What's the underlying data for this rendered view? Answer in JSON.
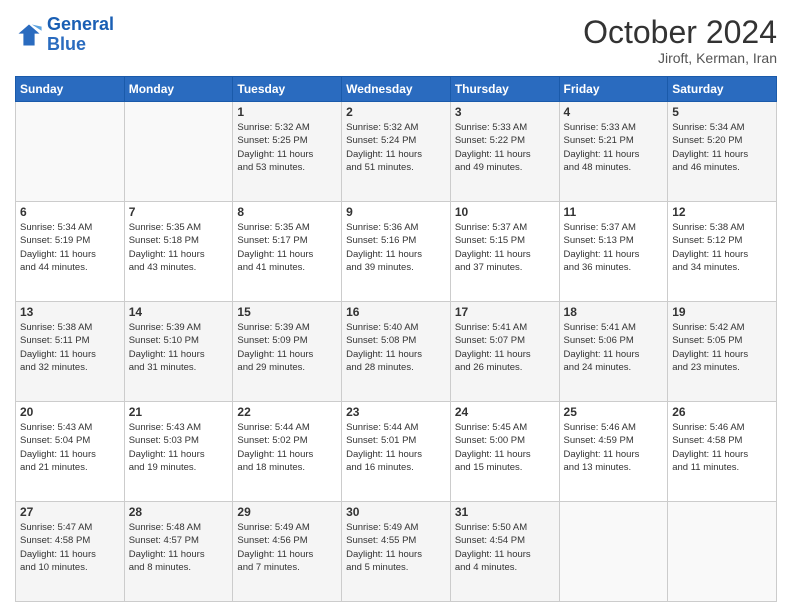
{
  "header": {
    "logo_line1": "General",
    "logo_line2": "Blue",
    "month_title": "October 2024",
    "subtitle": "Jiroft, Kerman, Iran"
  },
  "weekdays": [
    "Sunday",
    "Monday",
    "Tuesday",
    "Wednesday",
    "Thursday",
    "Friday",
    "Saturday"
  ],
  "weeks": [
    [
      {
        "day": "",
        "info": ""
      },
      {
        "day": "",
        "info": ""
      },
      {
        "day": "1",
        "info": "Sunrise: 5:32 AM\nSunset: 5:25 PM\nDaylight: 11 hours\nand 53 minutes."
      },
      {
        "day": "2",
        "info": "Sunrise: 5:32 AM\nSunset: 5:24 PM\nDaylight: 11 hours\nand 51 minutes."
      },
      {
        "day": "3",
        "info": "Sunrise: 5:33 AM\nSunset: 5:22 PM\nDaylight: 11 hours\nand 49 minutes."
      },
      {
        "day": "4",
        "info": "Sunrise: 5:33 AM\nSunset: 5:21 PM\nDaylight: 11 hours\nand 48 minutes."
      },
      {
        "day": "5",
        "info": "Sunrise: 5:34 AM\nSunset: 5:20 PM\nDaylight: 11 hours\nand 46 minutes."
      }
    ],
    [
      {
        "day": "6",
        "info": "Sunrise: 5:34 AM\nSunset: 5:19 PM\nDaylight: 11 hours\nand 44 minutes."
      },
      {
        "day": "7",
        "info": "Sunrise: 5:35 AM\nSunset: 5:18 PM\nDaylight: 11 hours\nand 43 minutes."
      },
      {
        "day": "8",
        "info": "Sunrise: 5:35 AM\nSunset: 5:17 PM\nDaylight: 11 hours\nand 41 minutes."
      },
      {
        "day": "9",
        "info": "Sunrise: 5:36 AM\nSunset: 5:16 PM\nDaylight: 11 hours\nand 39 minutes."
      },
      {
        "day": "10",
        "info": "Sunrise: 5:37 AM\nSunset: 5:15 PM\nDaylight: 11 hours\nand 37 minutes."
      },
      {
        "day": "11",
        "info": "Sunrise: 5:37 AM\nSunset: 5:13 PM\nDaylight: 11 hours\nand 36 minutes."
      },
      {
        "day": "12",
        "info": "Sunrise: 5:38 AM\nSunset: 5:12 PM\nDaylight: 11 hours\nand 34 minutes."
      }
    ],
    [
      {
        "day": "13",
        "info": "Sunrise: 5:38 AM\nSunset: 5:11 PM\nDaylight: 11 hours\nand 32 minutes."
      },
      {
        "day": "14",
        "info": "Sunrise: 5:39 AM\nSunset: 5:10 PM\nDaylight: 11 hours\nand 31 minutes."
      },
      {
        "day": "15",
        "info": "Sunrise: 5:39 AM\nSunset: 5:09 PM\nDaylight: 11 hours\nand 29 minutes."
      },
      {
        "day": "16",
        "info": "Sunrise: 5:40 AM\nSunset: 5:08 PM\nDaylight: 11 hours\nand 28 minutes."
      },
      {
        "day": "17",
        "info": "Sunrise: 5:41 AM\nSunset: 5:07 PM\nDaylight: 11 hours\nand 26 minutes."
      },
      {
        "day": "18",
        "info": "Sunrise: 5:41 AM\nSunset: 5:06 PM\nDaylight: 11 hours\nand 24 minutes."
      },
      {
        "day": "19",
        "info": "Sunrise: 5:42 AM\nSunset: 5:05 PM\nDaylight: 11 hours\nand 23 minutes."
      }
    ],
    [
      {
        "day": "20",
        "info": "Sunrise: 5:43 AM\nSunset: 5:04 PM\nDaylight: 11 hours\nand 21 minutes."
      },
      {
        "day": "21",
        "info": "Sunrise: 5:43 AM\nSunset: 5:03 PM\nDaylight: 11 hours\nand 19 minutes."
      },
      {
        "day": "22",
        "info": "Sunrise: 5:44 AM\nSunset: 5:02 PM\nDaylight: 11 hours\nand 18 minutes."
      },
      {
        "day": "23",
        "info": "Sunrise: 5:44 AM\nSunset: 5:01 PM\nDaylight: 11 hours\nand 16 minutes."
      },
      {
        "day": "24",
        "info": "Sunrise: 5:45 AM\nSunset: 5:00 PM\nDaylight: 11 hours\nand 15 minutes."
      },
      {
        "day": "25",
        "info": "Sunrise: 5:46 AM\nSunset: 4:59 PM\nDaylight: 11 hours\nand 13 minutes."
      },
      {
        "day": "26",
        "info": "Sunrise: 5:46 AM\nSunset: 4:58 PM\nDaylight: 11 hours\nand 11 minutes."
      }
    ],
    [
      {
        "day": "27",
        "info": "Sunrise: 5:47 AM\nSunset: 4:58 PM\nDaylight: 11 hours\nand 10 minutes."
      },
      {
        "day": "28",
        "info": "Sunrise: 5:48 AM\nSunset: 4:57 PM\nDaylight: 11 hours\nand 8 minutes."
      },
      {
        "day": "29",
        "info": "Sunrise: 5:49 AM\nSunset: 4:56 PM\nDaylight: 11 hours\nand 7 minutes."
      },
      {
        "day": "30",
        "info": "Sunrise: 5:49 AM\nSunset: 4:55 PM\nDaylight: 11 hours\nand 5 minutes."
      },
      {
        "day": "31",
        "info": "Sunrise: 5:50 AM\nSunset: 4:54 PM\nDaylight: 11 hours\nand 4 minutes."
      },
      {
        "day": "",
        "info": ""
      },
      {
        "day": "",
        "info": ""
      }
    ]
  ]
}
